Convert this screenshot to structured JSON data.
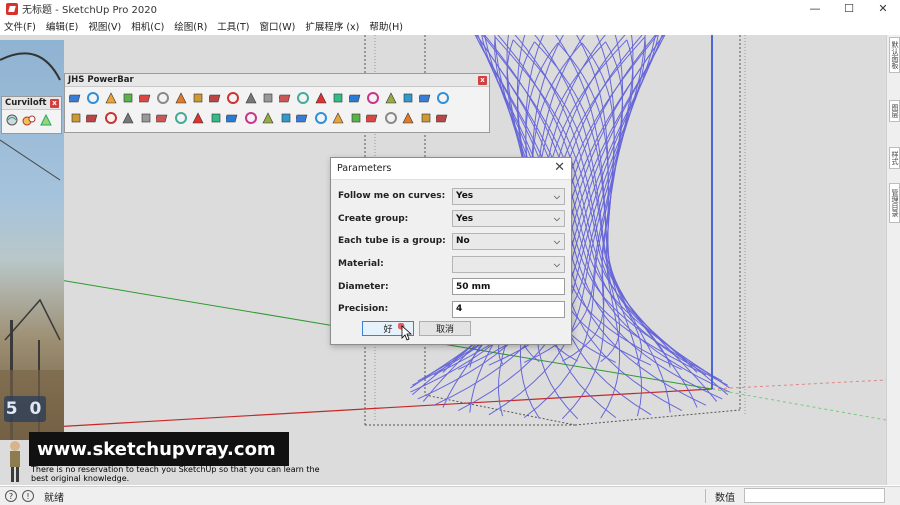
{
  "window": {
    "title": "无标题 - SketchUp Pro 2020",
    "controls": [
      "—",
      "☐",
      "✕"
    ]
  },
  "menu": [
    "文件(F)",
    "编辑(E)",
    "视图(V)",
    "相机(C)",
    "绘图(R)",
    "工具(T)",
    "窗口(W)",
    "扩展程序 (x)",
    "帮助(H)"
  ],
  "toolbars": {
    "curviloft": {
      "title": "Curviloft"
    },
    "jhs": {
      "title": "JHS PowerBar"
    }
  },
  "right_tabs": [
    "默认面板",
    "图层",
    "样式",
    "管理目录"
  ],
  "camera": {
    "badge": "5 0"
  },
  "dialog": {
    "title": "Parameters",
    "fields": [
      {
        "label": "Follow me on curves:",
        "type": "select",
        "value": "Yes"
      },
      {
        "label": "Create group:",
        "type": "select",
        "value": "Yes"
      },
      {
        "label": "Each tube is a group:",
        "type": "select",
        "value": "No"
      },
      {
        "label": "Material:",
        "type": "select",
        "value": ""
      },
      {
        "label": "Diameter:",
        "type": "text",
        "value": "50 mm"
      },
      {
        "label": "Precision:",
        "type": "text",
        "value": "4"
      }
    ],
    "ok": "好",
    "cancel": "取消"
  },
  "watermark": {
    "url": "www.sketchupvray.com",
    "sub": "There is no reservation to teach you SketchUp so that you can learn the best original knowledge."
  },
  "status": {
    "text": "就绪",
    "measure_label": "数值",
    "measure_value": ""
  },
  "colors": {
    "accent": "#3c7fd5",
    "mesh": "#5b5bd9",
    "axis_red": "#c62828",
    "axis_green": "#2e9b2e",
    "axis_blue": "#1f3fd0"
  }
}
